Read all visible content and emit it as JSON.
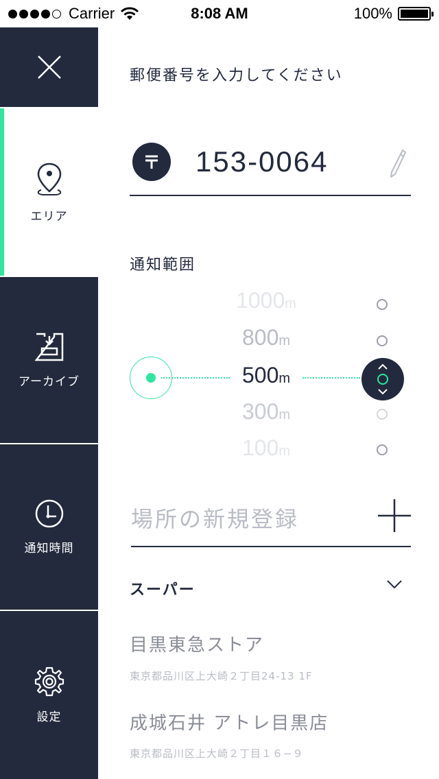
{
  "status_bar": {
    "carrier": "Carrier",
    "time": "8:08 AM",
    "battery": "100%"
  },
  "sidebar": {
    "items": [
      {
        "id": "close",
        "icon": "close-icon",
        "label": ""
      },
      {
        "id": "area",
        "icon": "map-pin-icon",
        "label": "エリア",
        "active": true
      },
      {
        "id": "archive",
        "icon": "archive-icon",
        "label": "アーカイブ"
      },
      {
        "id": "time",
        "icon": "clock-icon",
        "label": "通知時間"
      },
      {
        "id": "settings",
        "icon": "gear-icon",
        "label": "設定"
      }
    ]
  },
  "main": {
    "prompt": "郵便番号を入力してください",
    "postal_code": "153-0064",
    "range_title": "通知範囲",
    "range_options": [
      {
        "value": "1000",
        "unit": "m"
      },
      {
        "value": "800",
        "unit": "m"
      },
      {
        "value": "500",
        "unit": "m",
        "selected": true
      },
      {
        "value": "300",
        "unit": "m"
      },
      {
        "value": "100",
        "unit": "m"
      }
    ],
    "new_place_placeholder": "場所の新規登録",
    "category": "スーパー",
    "shops": [
      {
        "name": "目黒東急ストア",
        "address": "東京都品川区上大崎２丁目24-13 1F"
      },
      {
        "name": "成城石井 アトレ目黒店",
        "address": "東京都品川区上大崎２丁目１６−９"
      }
    ]
  },
  "colors": {
    "navy": "#232a3d",
    "accent": "#2ee6a0",
    "muted": "#b9bcc4"
  }
}
